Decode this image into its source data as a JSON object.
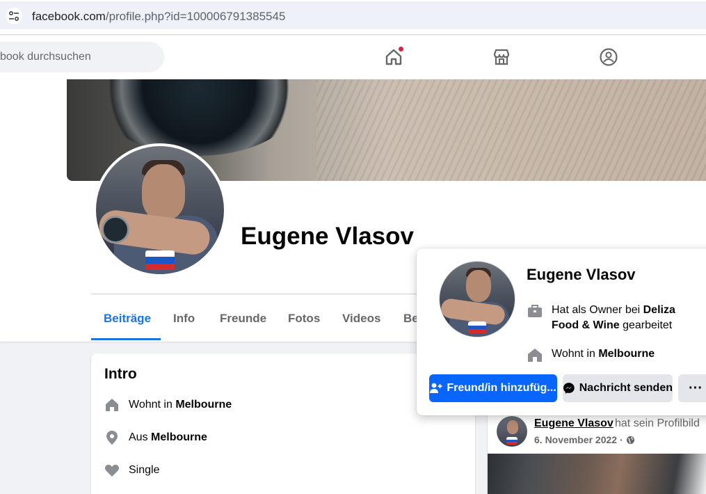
{
  "browser": {
    "url_host": "facebook.com",
    "url_path": "/profile.php?id=100006791385545"
  },
  "nav": {
    "search_placeholder": "book durchsuchen",
    "icons": [
      "home-icon",
      "marketplace-icon",
      "groups-icon"
    ]
  },
  "profile": {
    "name": "Eugene Vlasov",
    "tabs": [
      {
        "label": "Beiträge",
        "active": true
      },
      {
        "label": "Info"
      },
      {
        "label": "Freunde"
      },
      {
        "label": "Fotos"
      },
      {
        "label": "Videos"
      },
      {
        "label": "Be"
      }
    ]
  },
  "intro": {
    "title": "Intro",
    "rows": [
      {
        "prefix": "Wohnt in",
        "bold": "Melbourne",
        "icon": "house-icon"
      },
      {
        "prefix": "Aus",
        "bold": "Melbourne",
        "icon": "location-pin-icon"
      },
      {
        "prefix": "Single",
        "bold": "",
        "icon": "heart-icon"
      }
    ]
  },
  "hovercard": {
    "name": "Eugene Vlasov",
    "work_prefix": "Hat als Owner bei",
    "work_company": "Deliza Food & Wine",
    "work_suffix": "gearbeitet",
    "lives_prefix": "Wohnt in",
    "lives_city": "Melbourne",
    "add_friend_label": "Freund/in hinzufüg...",
    "message_label": "Nachricht senden",
    "more_label": "···"
  },
  "post": {
    "author": "Eugene Vlasov",
    "action": "hat sein Profilbild",
    "date": "6. November 2022 ·"
  },
  "colors": {
    "accent": "#1b74e4",
    "primary_button": "#0866ff",
    "notification": "#e41e3f"
  }
}
